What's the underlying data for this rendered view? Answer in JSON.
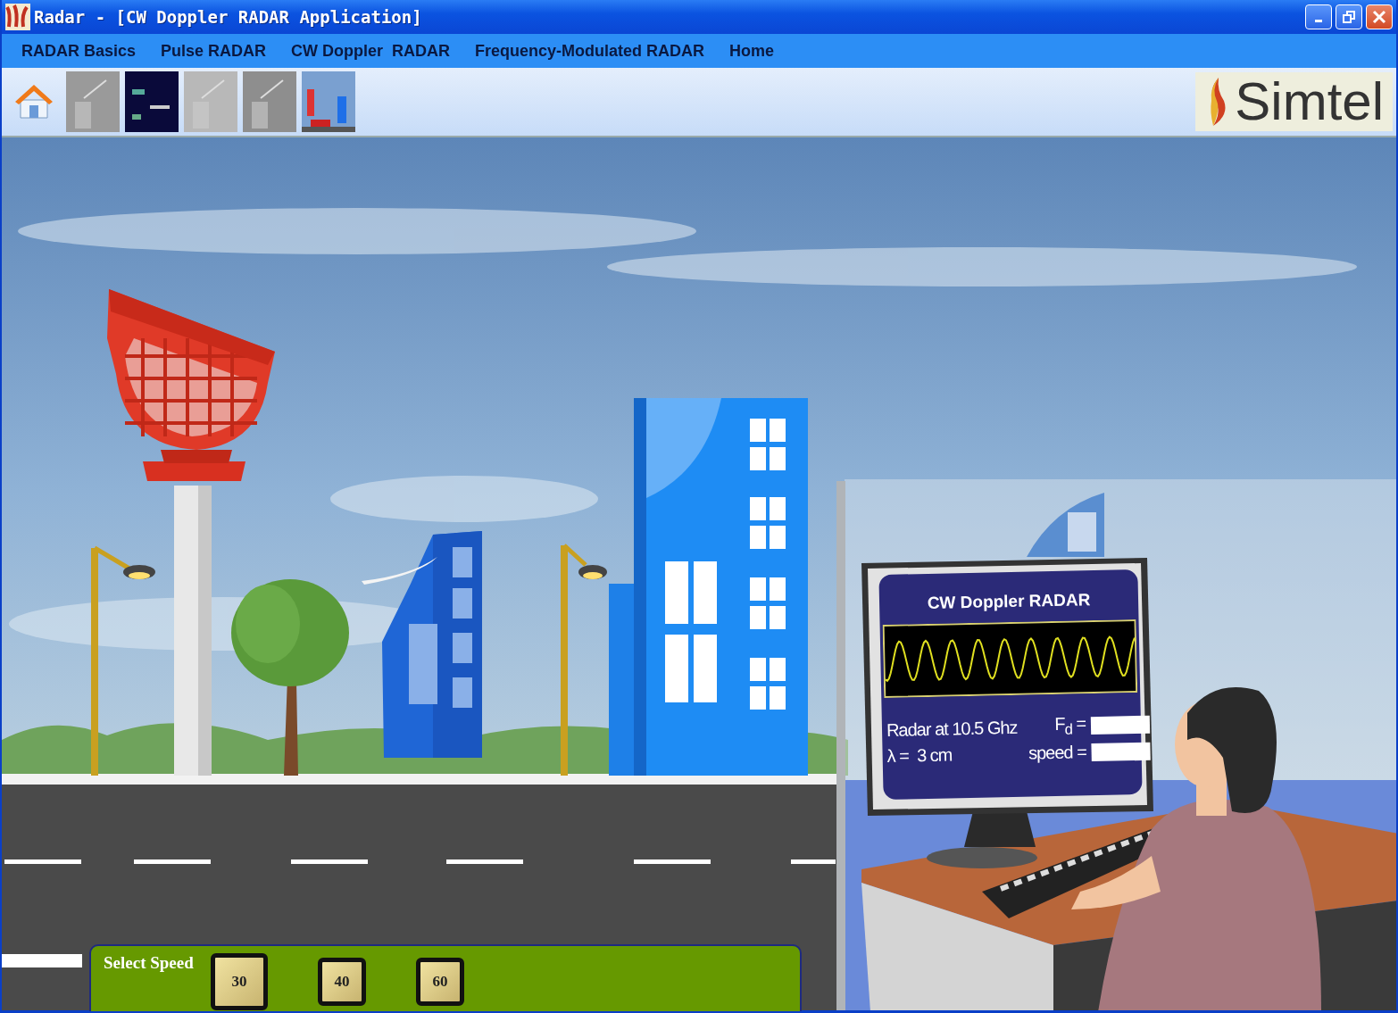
{
  "window": {
    "title": "Radar - [CW Doppler RADAR Application]"
  },
  "menu": [
    "RADAR Basics",
    "Pulse RADAR",
    "CW Doppler  RADAR",
    "Frequency-Modulated RADAR",
    "Home"
  ],
  "toolbar": {
    "logo": "Simtel"
  },
  "monitor": {
    "title": "CW Doppler RADAR",
    "frequency": "Radar at 10.5 Ghz",
    "wavelength": "λ =  3 cm",
    "doppler_label": "F$_{d}$ =",
    "speed_label": "speed ="
  },
  "speed_panel": {
    "label": "Select Speed",
    "options": [
      {
        "label": "30",
        "selected": true
      },
      {
        "label": "40",
        "selected": false
      },
      {
        "label": "60",
        "selected": false
      }
    ]
  }
}
